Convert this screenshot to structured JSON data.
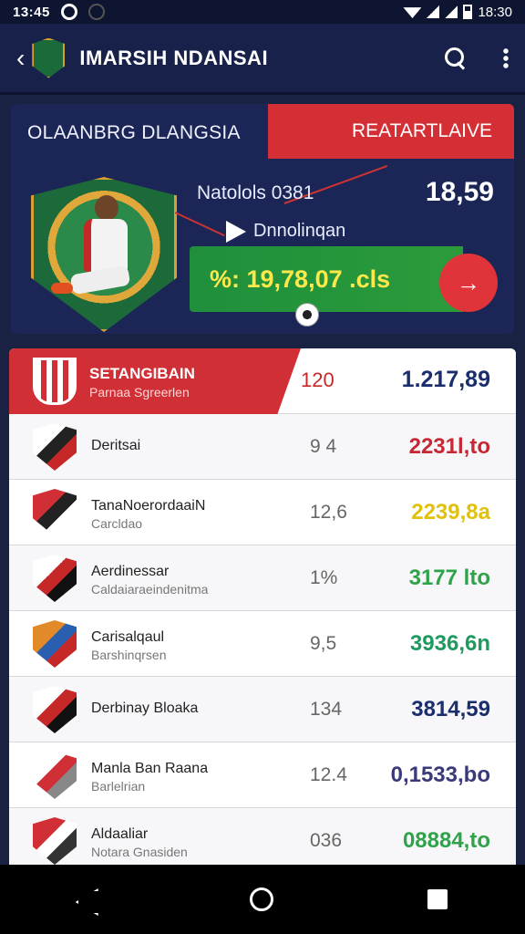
{
  "status_bar": {
    "time": "13:45",
    "clock_right": "18:30"
  },
  "app_bar": {
    "title": "IMARSIH NDANSAI",
    "icons": [
      "back-arrow-icon",
      "app-logo-icon",
      "search-icon",
      "more-vert-icon"
    ]
  },
  "hero": {
    "title": "OLAANBRG DLANGSIA",
    "badge": "REATARTLAIVE",
    "label": "Natolols 0381",
    "value": "18,59",
    "sublabel": "Dnnolinqan",
    "band_text": "%: 19,78,07 .cls",
    "go_icon": "→"
  },
  "table": {
    "header": {
      "title": "SETANGIBAIN",
      "subtitle": "Parnaa Sgreerlen",
      "num": "120",
      "value": "1.217,89"
    },
    "rows": [
      {
        "name": "Deritsai",
        "sub": "",
        "num": "9 4",
        "value": "2231l,to",
        "value_color": "#c62836",
        "logo_colors": [
          "#ffffff",
          "#222222",
          "#c62828"
        ]
      },
      {
        "name": "TanaNoerordaaiN",
        "sub": "Carcldao",
        "num": "12,6",
        "value": "2239,8a",
        "value_color": "#e0c20e",
        "logo_colors": [
          "#d12f36",
          "#222222",
          "#ffffff"
        ]
      },
      {
        "name": "Aerdinessar",
        "sub": "Caldaiaraeindenitma",
        "num": "1%",
        "value": "3177 lto",
        "value_color": "#2fa34a",
        "logo_colors": [
          "#ffffff",
          "#c62828",
          "#111111"
        ]
      },
      {
        "name": "Carisalqaul",
        "sub": "Barshinqrsen",
        "num": "9,5",
        "value": "3936,6n",
        "value_color": "#1e9a5e",
        "logo_colors": [
          "#e28a2a",
          "#2a5fb0",
          "#c62828"
        ]
      },
      {
        "name": "Derbinay Bloaka",
        "sub": "",
        "num": "134",
        "value": "3814,59",
        "value_color": "#1a2e6e",
        "logo_colors": [
          "#ffffff",
          "#c62828",
          "#111111"
        ]
      },
      {
        "name": "Manla Ban Raana",
        "sub": "Barlelrian",
        "num": "12.4",
        "value": "0,1533,bo",
        "value_color": "#3a3a7a",
        "logo_colors": [
          "#ffffff",
          "#d12f36",
          "#888888"
        ]
      },
      {
        "name": "Aldaaliar",
        "sub": "Notara Gnasiden",
        "num": "036",
        "value": "08884,to",
        "value_color": "#2fa34a",
        "logo_colors": [
          "#d12f36",
          "#ffffff",
          "#333333"
        ]
      }
    ]
  },
  "nav": {
    "icons": [
      "nav-back-icon",
      "nav-home-icon",
      "nav-recent-icon"
    ]
  }
}
